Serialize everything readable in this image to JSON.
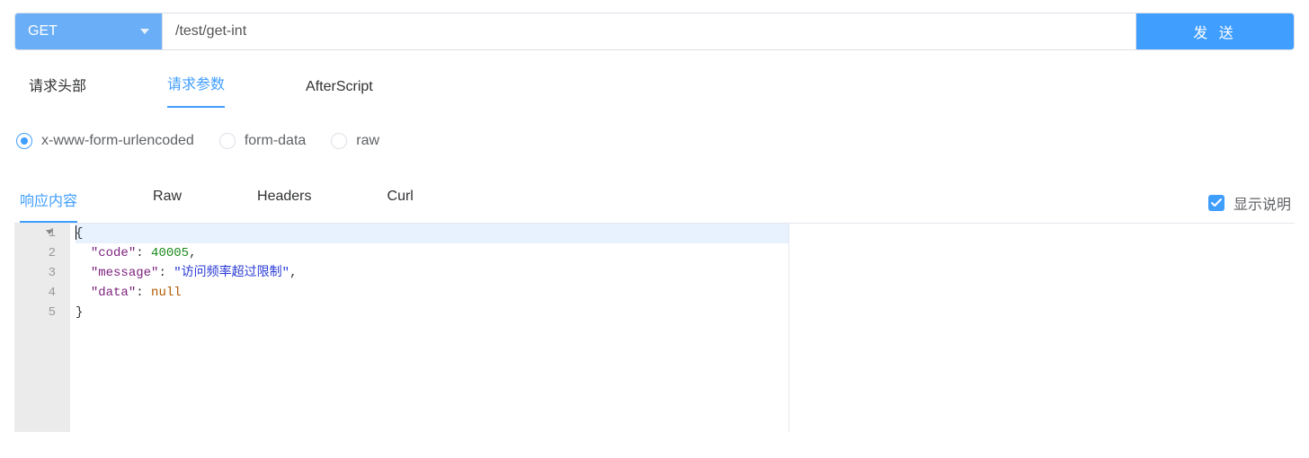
{
  "request": {
    "method": "GET",
    "url": "/test/get-int",
    "send_label": "发 送"
  },
  "request_tabs": {
    "headers": "请求头部",
    "params": "请求参数",
    "afterscript": "AfterScript",
    "active": "params"
  },
  "body_type": {
    "urlencoded": "x-www-form-urlencoded",
    "formdata": "form-data",
    "raw": "raw",
    "selected": "urlencoded"
  },
  "response_tabs": {
    "body": "响应内容",
    "raw": "Raw",
    "headers": "Headers",
    "curl": "Curl",
    "active": "body"
  },
  "show_description_label": "显示说明",
  "show_description_checked": true,
  "response_json": {
    "code": 40005,
    "message": "访问频率超过限制",
    "data": null
  },
  "editor_lines": {
    "l1": "{",
    "l2_key": "\"code\"",
    "l2_sep": ": ",
    "l2_val": "40005",
    "l2_tail": ",",
    "l3_key": "\"message\"",
    "l3_sep": ": ",
    "l3_val": "\"访问频率超过限制\"",
    "l3_tail": ",",
    "l4_key": "\"data\"",
    "l4_sep": ": ",
    "l4_val": "null",
    "l5": "}",
    "ln1": "1",
    "ln2": "2",
    "ln3": "3",
    "ln4": "4",
    "ln5": "5"
  }
}
